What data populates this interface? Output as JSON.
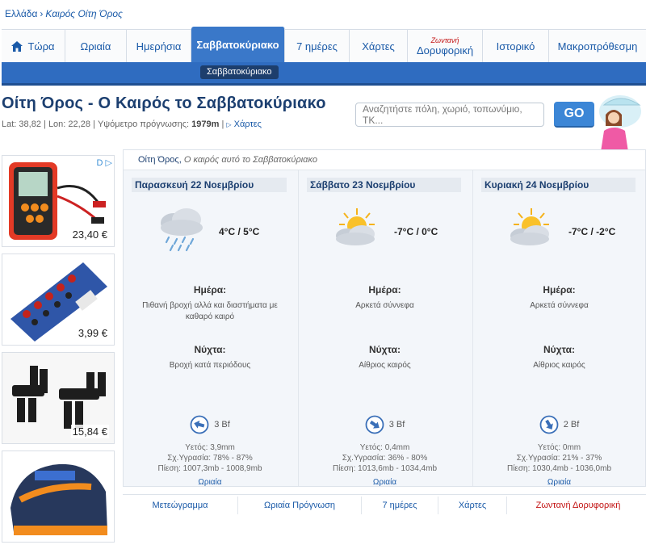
{
  "breadcrumb": {
    "root": "Ελλάδα",
    "current": "Καιρός Οίτη Όρος"
  },
  "nav": {
    "items": [
      {
        "label": "Τώρα",
        "icon": "home-icon"
      },
      {
        "label": "Ωριαία"
      },
      {
        "label": "Ημερήσια"
      },
      {
        "label": "Σαββατοκύριακο",
        "active": true
      },
      {
        "label": "7 ημέρες"
      },
      {
        "label": "Χάρτες"
      },
      {
        "label": "Δορυφορική",
        "live": "Ζωντανή"
      },
      {
        "label": "Ιστορικό"
      },
      {
        "label": "Μακροπρόθεσμη"
      }
    ],
    "sub_chip": "Σαββατοκύριακο"
  },
  "page_title": "Οίτη Όρος - Ο Καιρός το Σαββατοκύριακο",
  "geo": {
    "lat_label": "Lat:",
    "lat": "38,82",
    "lon_label": "Lon:",
    "lon": "22,28",
    "alt_label": "Υψόμετρο πρόγνωσης:",
    "alt": "1979m",
    "maps": "Χάρτες"
  },
  "search": {
    "placeholder": "Αναζητήστε πόλη, χωριό, τοπωνύμιο, ΤΚ...",
    "go_label": "GO"
  },
  "ads": {
    "choice_label": "D ▷",
    "prices": [
      "23,40 €",
      "3,99 €",
      "15,84 €",
      ""
    ]
  },
  "forecast": {
    "place": "Οίτη Όρος,",
    "subtitle": "Ο καιρός αυτό το Σαββατοκύριακο",
    "day_label": "Ημέρα:",
    "night_label": "Νύχτα:",
    "rain_label": "Υετός:",
    "humidity_label": "Σχ.Υγρασία:",
    "pressure_label": "Πίεση:",
    "hourly_label": "Ωριαία",
    "days": [
      {
        "title": "Παρασκευή 22 Νοεμβρίου",
        "icon": "rain-cloud-icon",
        "temp": "4°C / 5°C",
        "day_desc": "Πιθανή βροχή αλλά και διαστήματα με καθαρό καιρό",
        "night_desc": "Βροχή κατά περιόδους",
        "wind": "3 Bf",
        "wind_dir": "west-wind-arrow-icon",
        "rain": "3,9mm",
        "humidity": "78% - 87%",
        "pressure": "1007,3mb - 1008,9mb"
      },
      {
        "title": "Σάββατο 23 Νοεμβρίου",
        "icon": "sun-cloud-icon",
        "temp": "-7°C / 0°C",
        "day_desc": "Αρκετά σύννεφα",
        "night_desc": "Αίθριος καιρός",
        "wind": "3 Bf",
        "wind_dir": "northwest-wind-arrow-icon",
        "rain": "0,4mm",
        "humidity": "36% - 80%",
        "pressure": "1013,6mb - 1034,4mb"
      },
      {
        "title": "Κυριακή 24 Νοεμβρίου",
        "icon": "sun-cloud-icon",
        "temp": "-7°C / -2°C",
        "day_desc": "Αρκετά σύννεφα",
        "night_desc": "Αίθριος καιρός",
        "wind": "2 Bf",
        "wind_dir": "north-wind-arrow-icon",
        "rain": "0mm",
        "humidity": "21% - 37%",
        "pressure": "1030,4mb - 1036,0mb"
      }
    ]
  },
  "bottom_links": [
    "Μετεώγραμμα",
    "Ωριαία Πρόγνωση",
    "7 ημέρες",
    "Χάρτες",
    "Ζωντανή Δορυφορική"
  ],
  "colors": {
    "brand_blue": "#2f6cc0",
    "link": "#1a5aa8",
    "live_red": "#c31414",
    "title": "#1c3f70"
  }
}
